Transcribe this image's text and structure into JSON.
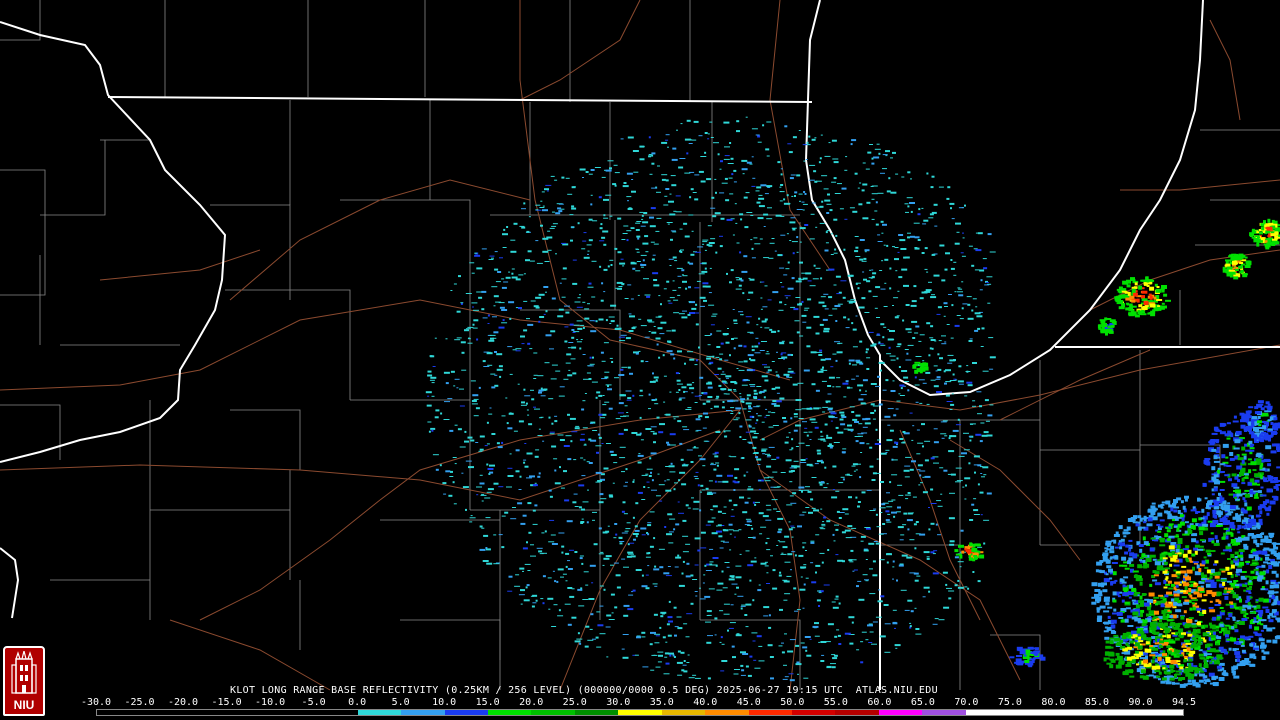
{
  "caption": "KLOT LONG RANGE BASE REFLECTIVITY (0.25KM / 256 LEVEL) (000000/0000 0.5 DEG) 2025-06-27 19:15 UTC  ATLAS.NIU.EDU",
  "colorbar": {
    "ticks": [
      "-30.0",
      "-25.0",
      "-20.0",
      "-15.0",
      "-10.0",
      "-5.0",
      "0.0",
      "5.0",
      "10.0",
      "15.0",
      "20.0",
      "25.0",
      "30.0",
      "35.0",
      "40.0",
      "45.0",
      "50.0",
      "55.0",
      "60.0",
      "65.0",
      "70.0",
      "75.0",
      "80.0",
      "85.0",
      "90.0",
      "94.5"
    ],
    "colors": [
      "#000000",
      "#000000",
      "#000000",
      "#000000",
      "#000000",
      "#000000",
      "#2fd8d8",
      "#33a0f0",
      "#1a3cf0",
      "#00e000",
      "#00c000",
      "#009000",
      "#ffff00",
      "#e6b800",
      "#ff8c00",
      "#ff2a00",
      "#d40000",
      "#b40000",
      "#ff00ff",
      "#a050e0",
      "#ffffff",
      "#ffffff",
      "#ffffff",
      "#ffffff",
      "#ffffff"
    ]
  },
  "logo": {
    "text": "NIU",
    "color": "#b00000"
  },
  "map_layers": {
    "state_borders": "#ffffff",
    "county_lines": "#8a8a8a",
    "roads": "#8b4a2f",
    "reflectivity_colors": [
      "#2fd8d8",
      "#33a0f0",
      "#1a3cf0",
      "#00e000",
      "#00b000",
      "#ffff00",
      "#ff8c00",
      "#ff2a00"
    ]
  },
  "radar_site": "KLOT"
}
